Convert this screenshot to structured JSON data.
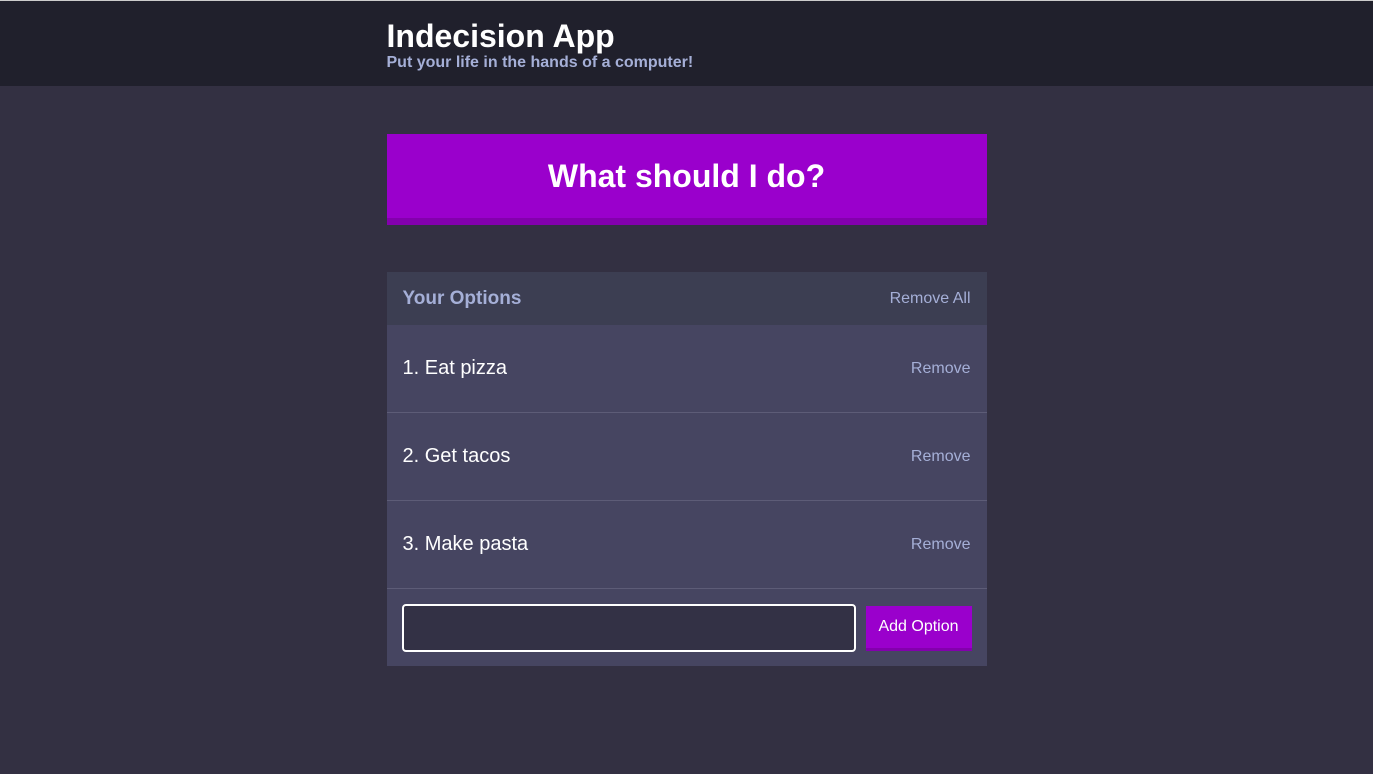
{
  "header": {
    "title": "Indecision App",
    "subtitle": "Put your life in the hands of a computer!"
  },
  "action": {
    "label": "What should I do?"
  },
  "options_widget": {
    "title": "Your Options",
    "remove_all_label": "Remove All",
    "items": [
      {
        "text": "1. Eat pizza",
        "remove_label": "Remove"
      },
      {
        "text": "2. Get tacos",
        "remove_label": "Remove"
      },
      {
        "text": "3. Make pasta",
        "remove_label": "Remove"
      }
    ],
    "input_value": "",
    "add_label": "Add Option"
  },
  "colors": {
    "accent": "#9a00cc",
    "background": "#333042",
    "header": "#20202c",
    "muted_text": "#a5afd7"
  }
}
